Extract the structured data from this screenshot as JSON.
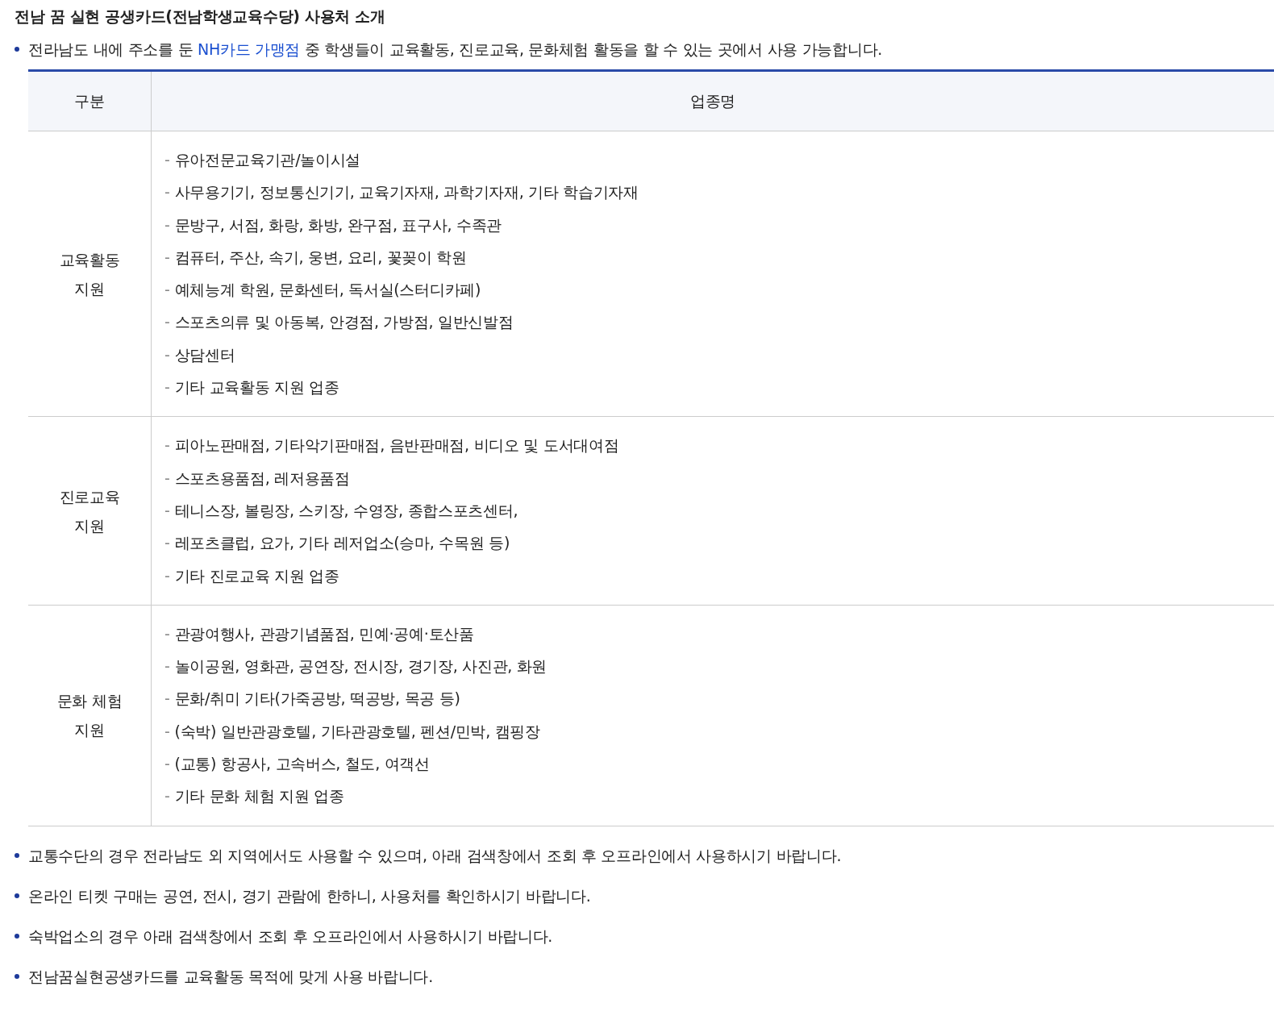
{
  "title": "전남 꿈 실현 공생카드(전남학생교육수당) 사용처 소개",
  "intro": {
    "before": "전라남도 내에 주소를 둔 ",
    "link": "NH카드 가맹점",
    "after": " 중 학생들이 교육활동, 진로교육, 문화체험 활동을 할 수 있는 곳에서 사용 가능합니다."
  },
  "table": {
    "columns": [
      "구분",
      "업종명"
    ],
    "rows": [
      {
        "category": [
          "교육활동",
          "지원"
        ],
        "items": [
          {
            "marker": "-",
            "text": "유아전문교육기관/놀이시설"
          },
          {
            "marker": "-",
            "text": "사무용기기, 정보통신기기, 교육기자재, 과학기자재, 기타 학습기자재"
          },
          {
            "marker": "-",
            "text": "문방구, 서점, 화랑, 화방, 완구점, 표구사, 수족관"
          },
          {
            "marker": "-",
            "text": "컴퓨터, 주산, 속기, 웅변, 요리, 꽃꽂이 학원"
          },
          {
            "marker": "-",
            "text": "예체능계 학원, 문화센터, 독서실(스터디카페)"
          },
          {
            "marker": "-",
            "text": "스포츠의류 및 아동복, 안경점, 가방점, 일반신발점"
          },
          {
            "marker": "-",
            "text": "상담센터"
          },
          {
            "marker": "-",
            "text": "기타 교육활동 지원 업종"
          }
        ]
      },
      {
        "category": [
          "진로교육",
          "지원"
        ],
        "items": [
          {
            "marker": "-",
            "text": "피아노판매점, 기타악기판매점, 음반판매점, 비디오 및 도서대여점"
          },
          {
            "marker": "-",
            "text": "스포츠용품점, 레저용품점"
          },
          {
            "marker": "-",
            "text": "테니스장, 볼링장, 스키장, 수영장, 종합스포츠센터,"
          },
          {
            "marker": "-",
            "text": "레포츠클럽, 요가, 기타 레저업소(승마, 수목원 등)"
          },
          {
            "marker": "-",
            "text": "기타 진로교육 지원 업종"
          }
        ]
      },
      {
        "category": [
          "문화 체험",
          "지원"
        ],
        "items": [
          {
            "marker": "-",
            "text": "관광여행사, 관광기념품점, 민예·공예·토산품"
          },
          {
            "marker": "-",
            "text": "놀이공원, 영화관, 공연장, 전시장, 경기장, 사진관, 화원"
          },
          {
            "marker": "-",
            "text": "문화/취미 기타(가죽공방, 떡공방, 목공 등)"
          },
          {
            "marker": "-",
            "text": "(숙박) 일반관광호텔, 기타관광호텔, 펜션/민박, 캠핑장"
          },
          {
            "marker": "-",
            "text": "(교통) 항공사, 고속버스, 철도, 여객선"
          },
          {
            "marker": "-",
            "text": "기타 문화 체험 지원 업종"
          }
        ]
      }
    ]
  },
  "notes": [
    "교통수단의 경우 전라남도 외 지역에서도 사용할 수 있으며, 아래 검색창에서 조회 후 오프라인에서 사용하시기 바랍니다.",
    "온라인 티켓 구매는 공연, 전시, 경기 관람에 한하니, 사용처를 확인하시기 바랍니다.",
    "숙박업소의 경우 아래 검색창에서 조회 후 오프라인에서 사용하시기 바랍니다.",
    "전남꿈실현공생카드를 교육활동 목적에 맞게 사용 바랍니다."
  ]
}
